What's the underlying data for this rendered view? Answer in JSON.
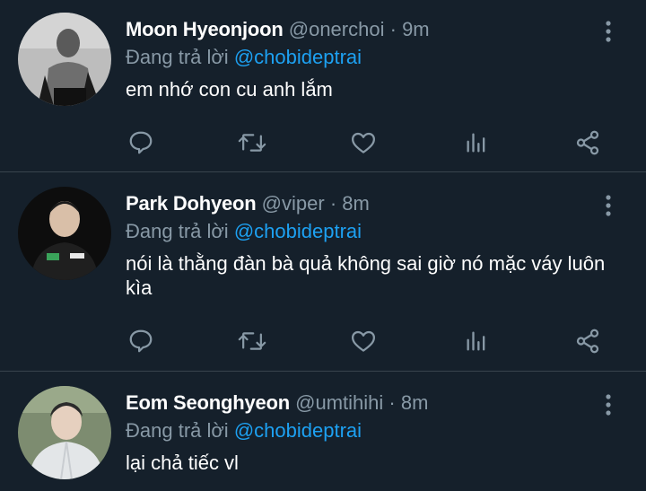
{
  "tweets": [
    {
      "name": "Moon Hyeonjoon",
      "handle": "@onerchoi",
      "separator": "·",
      "time": "9m",
      "reply_prefix": "Đang trả lời",
      "reply_to": "@chobideptrai",
      "text": "em nhớ con cu anh lắm"
    },
    {
      "name": "Park Dohyeon",
      "handle": "@viper",
      "separator": "·",
      "time": "8m",
      "reply_prefix": "Đang trả lời",
      "reply_to": "@chobideptrai",
      "text": "nói là thằng đàn bà quả không sai giờ nó mặc váy luôn kìa"
    },
    {
      "name": "Eom Seonghyeon",
      "handle": "@umtihihi",
      "separator": "·",
      "time": "8m",
      "reply_prefix": "Đang trả lời",
      "reply_to": "@chobideptrai",
      "text": "lại chả tiếc vl"
    }
  ],
  "icons": [
    "reply-icon",
    "retweet-icon",
    "like-icon",
    "analytics-icon",
    "share-icon",
    "more-icon"
  ],
  "colors": {
    "background": "#15202b",
    "secondary_text": "#8899a6",
    "mention": "#1da1f2",
    "divider": "#38444d"
  }
}
